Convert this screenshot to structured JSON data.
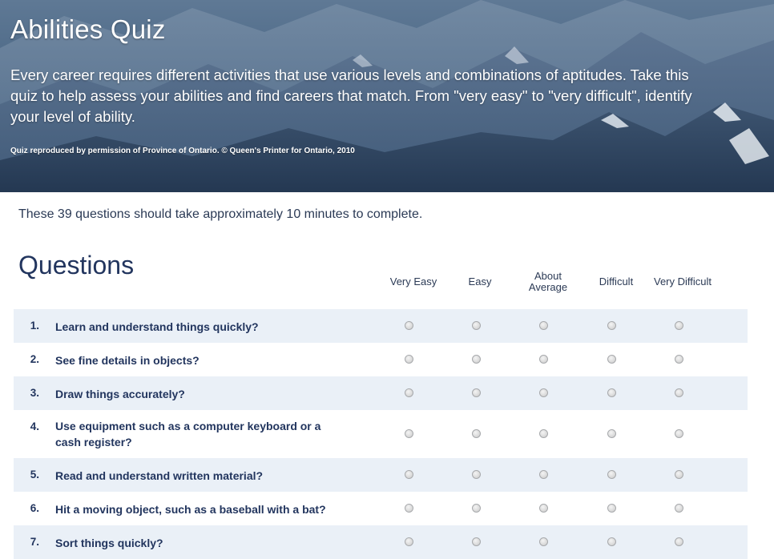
{
  "hero": {
    "title": "Abilities Quiz",
    "description": "Every career requires different activities that use various levels and combinations of aptitudes. Take this quiz to help assess your abilities and find careers that match. From \"very easy\" to \"very difficult\", identify your level of ability.",
    "credit": "Quiz reproduced by permission of Province of Ontario. © Queen's Printer for Ontario, 2010"
  },
  "intro": "These 39 questions should take approximately 10 minutes to complete.",
  "questions_heading": "Questions",
  "columns": [
    {
      "line1": "Very Easy",
      "line2": ""
    },
    {
      "line1": "Easy",
      "line2": ""
    },
    {
      "line1": "About",
      "line2": "Average"
    },
    {
      "line1": "Difficult",
      "line2": ""
    },
    {
      "line1": "Very Difficult",
      "line2": ""
    }
  ],
  "questions": [
    {
      "num": "1.",
      "text": "Learn and understand things quickly?"
    },
    {
      "num": "2.",
      "text": "See fine details in objects?"
    },
    {
      "num": "3.",
      "text": "Draw things accurately?"
    },
    {
      "num": "4.",
      "text": "Use equipment such as a computer keyboard or a cash register?"
    },
    {
      "num": "5.",
      "text": "Read and understand written material?"
    },
    {
      "num": "6.",
      "text": "Hit a moving object, such as a baseball with a bat?"
    },
    {
      "num": "7.",
      "text": "Sort things quickly?"
    }
  ],
  "colors": {
    "heading": "#22355e",
    "row_alt": "#eaf0f7",
    "text": "#2b3a55"
  }
}
